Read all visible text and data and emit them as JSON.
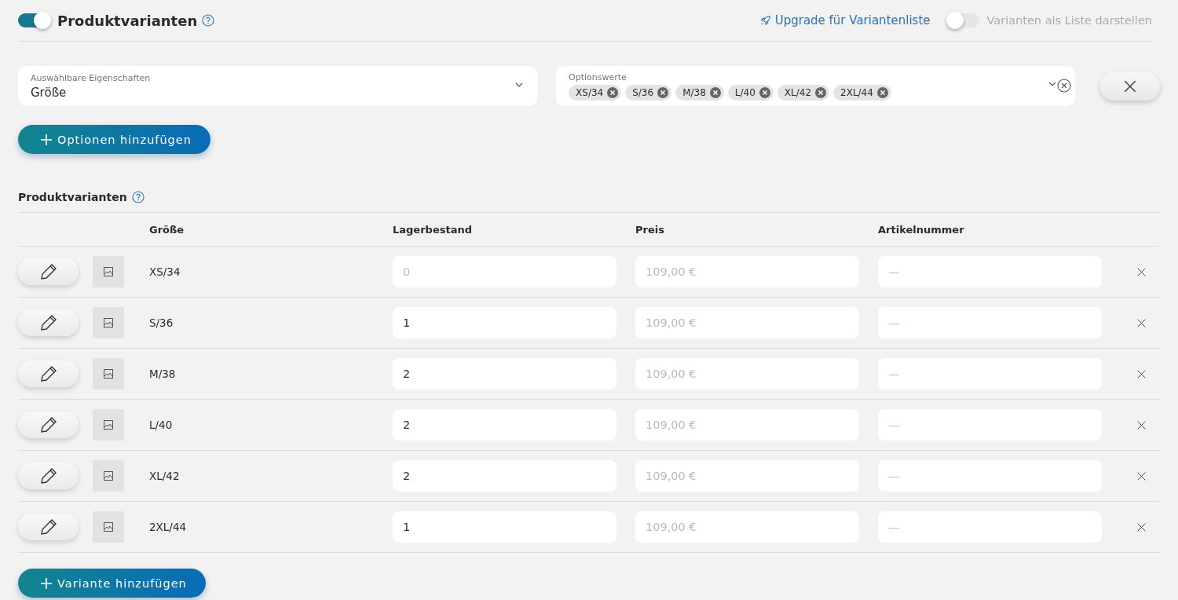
{
  "header": {
    "enabled": true,
    "title": "Produktvarianten",
    "upgrade_link": "Upgrade für Variantenliste",
    "list_toggle": {
      "on": false,
      "label": "Varianten als Liste darstellen"
    }
  },
  "property_select": {
    "label": "Auswählbare Eigenschaften",
    "value": "Größe"
  },
  "option_values": {
    "label": "Optionswerte",
    "tags": [
      "XS/34",
      "S/36",
      "M/38",
      "L/40",
      "XL/42",
      "2XL/44"
    ]
  },
  "add_options_button": "Optionen hinzufügen",
  "variants": {
    "title": "Produktvarianten",
    "columns": [
      "Größe",
      "Lagerbestand",
      "Preis",
      "Artikelnummer"
    ],
    "rows": [
      {
        "size": "XS/34",
        "stock": {
          "placeholder": "0"
        },
        "price": {
          "placeholder": "109,00 €"
        },
        "sku": {
          "placeholder": "—"
        }
      },
      {
        "size": "S/36",
        "stock": {
          "value": "1"
        },
        "price": {
          "placeholder": "109,00 €"
        },
        "sku": {
          "placeholder": "—"
        }
      },
      {
        "size": "M/38",
        "stock": {
          "value": "2"
        },
        "price": {
          "placeholder": "109,00 €"
        },
        "sku": {
          "placeholder": "—"
        }
      },
      {
        "size": "L/40",
        "stock": {
          "value": "2"
        },
        "price": {
          "placeholder": "109,00 €"
        },
        "sku": {
          "placeholder": "—"
        }
      },
      {
        "size": "XL/42",
        "stock": {
          "value": "2"
        },
        "price": {
          "placeholder": "109,00 €"
        },
        "sku": {
          "placeholder": "—"
        }
      },
      {
        "size": "2XL/44",
        "stock": {
          "value": "1"
        },
        "price": {
          "placeholder": "109,00 €"
        },
        "sku": {
          "placeholder": "—"
        }
      }
    ]
  },
  "add_variant_button": "Variante hinzufügen"
}
